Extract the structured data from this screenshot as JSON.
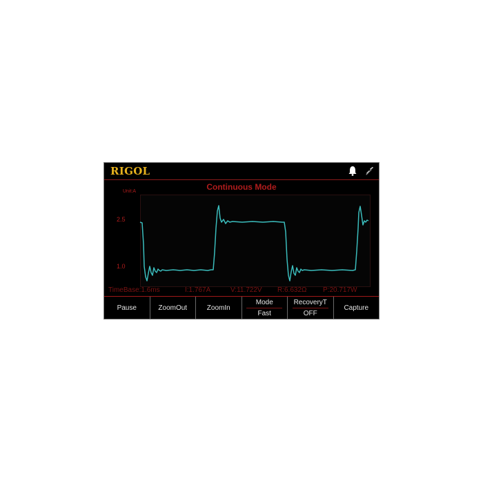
{
  "header": {
    "logo": "RIGOL",
    "icons": [
      "bell-icon",
      "link-icon"
    ],
    "logo_color": "#e7b21e"
  },
  "display": {
    "title": "Continuous Mode",
    "unit_label": "Unit:A",
    "y_ticks": [
      "2.5",
      "1.0"
    ],
    "trace_color": "#3bbdbd",
    "label_color": "#b01c1c"
  },
  "status": {
    "timebase": "TimeBase:1.6ms",
    "current": "I:1.767A",
    "voltage": "V:11.722V",
    "resistance": "R:6.632Ω",
    "power": "P:20.717W"
  },
  "softkeys": {
    "pause": "Pause",
    "zoom_out": "ZoomOut",
    "zoom_in": "ZoomIn",
    "mode_label": "Mode",
    "mode_value": "Fast",
    "recovery_label": "RecoveryT",
    "recovery_value": "OFF",
    "capture": "Capture"
  }
}
